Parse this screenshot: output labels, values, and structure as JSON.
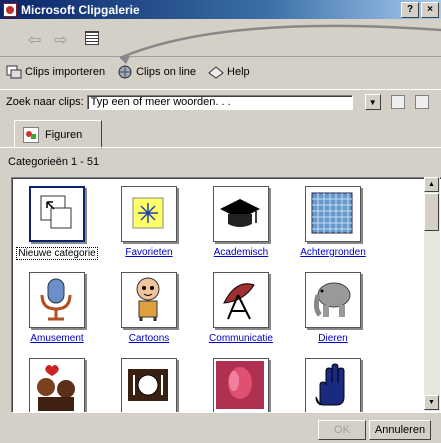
{
  "window": {
    "title": "Microsoft Clipgalerie",
    "help_btn": "?",
    "close_btn": "×"
  },
  "nav": {
    "back": "⇦",
    "forward": "⇨"
  },
  "toolbar": {
    "import_label": "Clips importeren",
    "online_label": "Clips on line",
    "help_label": "Help"
  },
  "search": {
    "label": "Zoek naar clips:",
    "value": "Typ een of meer woorden. . ."
  },
  "tab": {
    "label": "Figuren"
  },
  "category_count": "Categorieën 1 - 51",
  "categories": [
    {
      "label": "Nieuwe categorie",
      "icon": "new-category-icon"
    },
    {
      "label": "Favorieten",
      "icon": "star-icon"
    },
    {
      "label": "Academisch",
      "icon": "graduation-cap-icon"
    },
    {
      "label": "Achtergronden",
      "icon": "background-pattern-icon"
    },
    {
      "label": "Amusement",
      "icon": "microphone-icon"
    },
    {
      "label": "Cartoons",
      "icon": "cartoon-child-icon"
    },
    {
      "label": "Communicatie",
      "icon": "satellite-dish-icon"
    },
    {
      "label": "Dieren",
      "icon": "elephant-icon"
    },
    {
      "label": "",
      "icon": "couple-heart-icon"
    },
    {
      "label": "",
      "icon": "dining-icon"
    },
    {
      "label": "",
      "icon": "tulip-photo-icon"
    },
    {
      "label": "",
      "icon": "hand-icon"
    }
  ],
  "buttons": {
    "ok": "OK",
    "cancel": "Annuleren"
  }
}
